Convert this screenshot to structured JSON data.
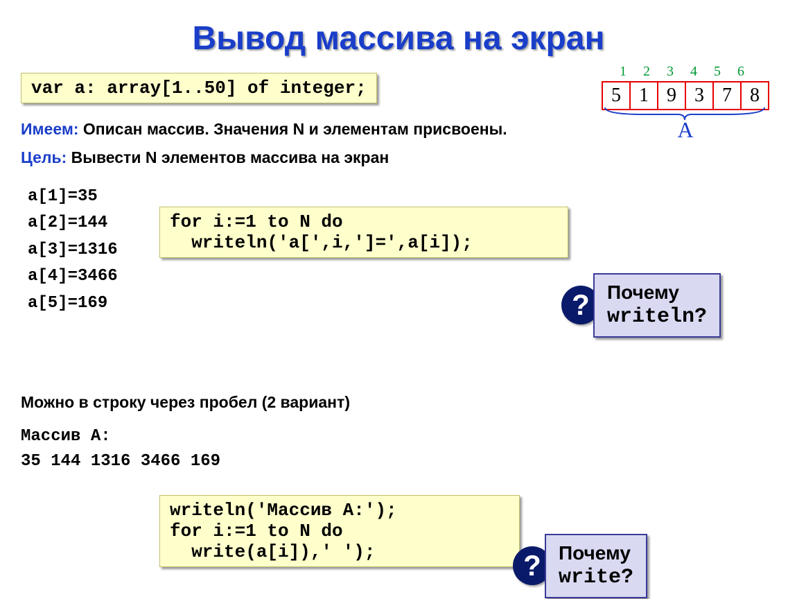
{
  "title": "Вывод массива на экран",
  "declaration_code": "var a: array[1..50] of integer;",
  "array_vis": {
    "indices": [
      "1",
      "2",
      "3",
      "4",
      "5",
      "6"
    ],
    "values": [
      "5",
      "1",
      "9",
      "3",
      "7",
      "8"
    ],
    "label": "A"
  },
  "have": {
    "label": "Имеем:",
    "text": " Описан массив. Значения N и элементам присвоены."
  },
  "goal": {
    "label": "Цель:",
    "text": " Вывести N элементов массива на экран"
  },
  "sample_lines": [
    "a[1]=35",
    "a[2]=144",
    "a[3]=1316",
    "a[4]=3466",
    "a[5]=169"
  ],
  "loop_code_1": "for i:=1 to N do\n  writeln('a[',i,']=',a[i]);",
  "callout_1": {
    "why": "Почему",
    "word": "writeln?"
  },
  "variant_line": "Можно в строку через пробел (2 вариант)",
  "array_output_title": "Массив A:",
  "array_output_values": "35 144 1316 3466 169",
  "loop_code_2": "writeln('Массив A:');\nfor i:=1 to N do\n  write(a[i]),' ');",
  "callout_2": {
    "why": "Почему",
    "word": "write?"
  },
  "qmark": "?"
}
